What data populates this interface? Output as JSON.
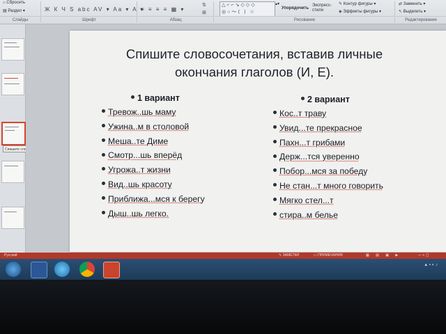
{
  "ribbon": {
    "clear_label": "Сбросить",
    "section_label": "Раздел",
    "arrange_label": "Упорядочить",
    "quick_styles_label": "Экспресс-стили",
    "shape_outline_label": "Контур фигуры",
    "shape_effects_label": "Эффекты фигуры",
    "replace_label": "Заменить",
    "select_label": "Выделить",
    "groups": {
      "slides": "Слайды",
      "font": "Шрифт",
      "paragraph": "Абзац",
      "drawing": "Рисование",
      "editing": "Редактирование"
    }
  },
  "thumbnail_tooltip": "Спишите словосочетания, в...",
  "slide": {
    "title_line1": "Спишите словосочетания, вставив личные",
    "title_line2": "окончания глаголов (И, Е).",
    "left_heading": "1 вариант",
    "right_heading": "2 вариант",
    "left_items": [
      "Тревож..шь маму",
      "Ужина..м в столовой",
      "Меша..те Диме",
      "Смотр...шь вперёд",
      "Угрожа..т жизни",
      "Вид..шь красоту",
      "Приближа...мся к берегу",
      "Дыш..шь легко."
    ],
    "right_items": [
      "Кос..т траву",
      "Увид...те прекрасное",
      "Пахн...т грибами",
      "Держ...тся уверенно",
      "Побор...мся за победу",
      "Не стан...т много говорить",
      "Мягко стел...т",
      "стира..м белье"
    ]
  },
  "status": {
    "language": "Русский",
    "notes_label": "ЗАМЕТКИ",
    "comments_label": "ПРИМЕЧАНИЯ"
  },
  "colors": {
    "slide_bg": "#f1f1ef",
    "status_bar": "#b1392a",
    "taskbar": "#1d3b59",
    "selected_thumb": "#d8432f"
  }
}
